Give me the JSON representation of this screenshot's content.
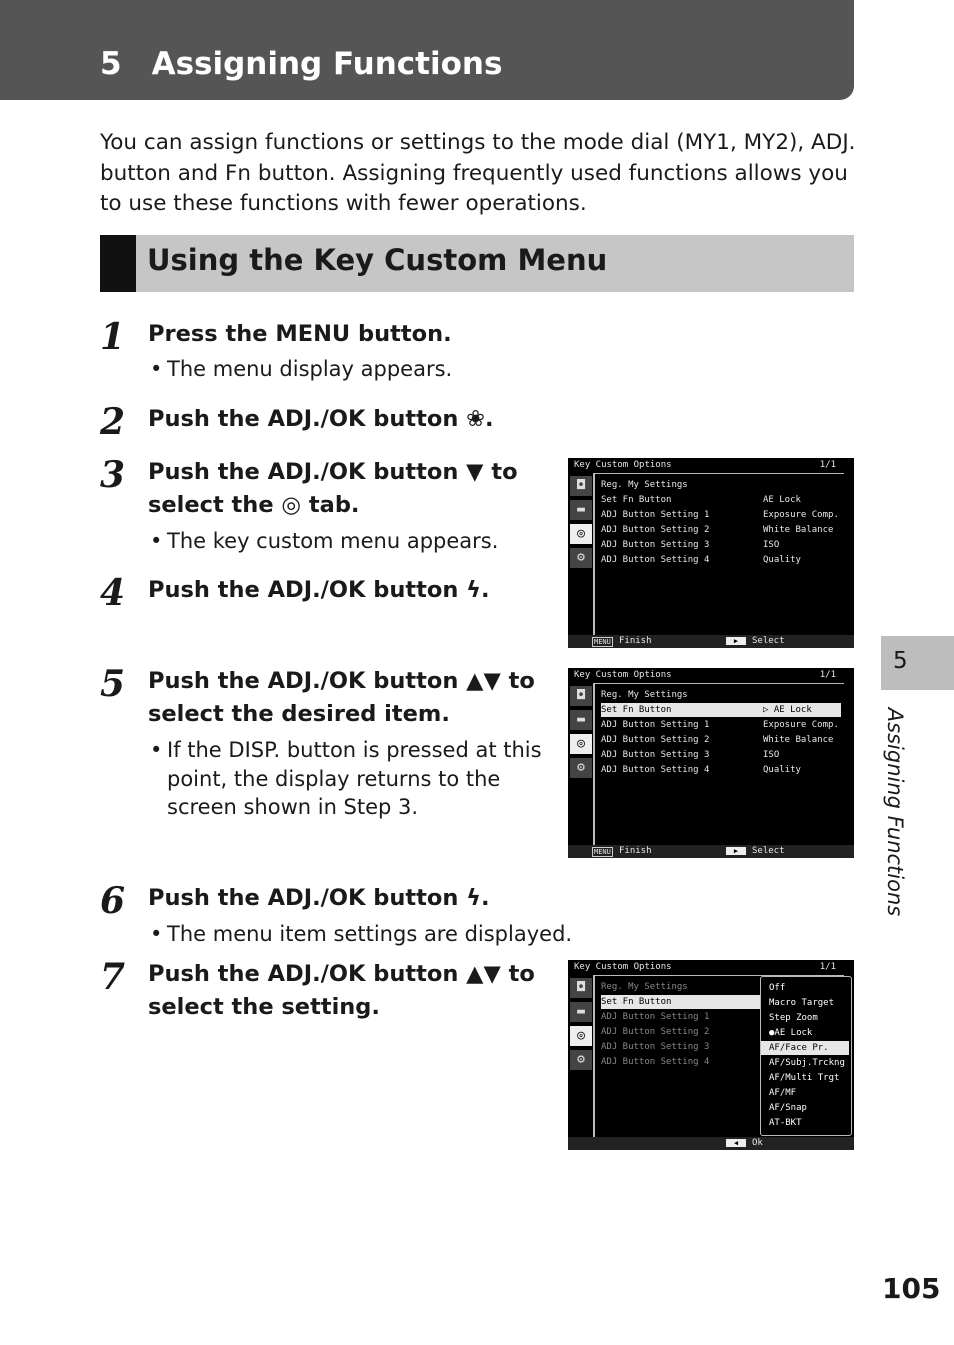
{
  "header": {
    "chapter": "5",
    "title": "Assigning Functions"
  },
  "intro": "You can assign functions or settings to the mode dial (MY1, MY2), ADJ. button and Fn button. Assigning frequently used functions allows you to use these functions with fewer operations.",
  "section_title": "Using the Key Custom Menu",
  "steps": [
    {
      "n": "1",
      "lines": [
        "Press the MENU button."
      ],
      "bullet": [
        "The menu display appears."
      ]
    },
    {
      "n": "2",
      "lines": [
        "Push the ADJ./OK button ❀."
      ]
    },
    {
      "n": "3",
      "lines": [
        "Push the ADJ./OK button ▼ to",
        "select the ◎ tab."
      ],
      "bullet": [
        "The key custom menu appears."
      ]
    },
    {
      "n": "4",
      "lines": [
        "Push the ADJ./OK button ϟ."
      ]
    },
    {
      "n": "5",
      "lines": [
        "Push the ADJ./OK button ▲▼ to",
        "select the desired item."
      ],
      "bullet": [
        "If the DISP. button is pressed at this",
        "point, the display returns to the",
        "screen shown in Step 3."
      ]
    },
    {
      "n": "6",
      "lines": [
        "Push the ADJ./OK button ϟ."
      ],
      "bullet": [
        "The menu item settings are displayed."
      ]
    },
    {
      "n": "7",
      "lines": [
        "Push the ADJ./OK button ▲▼ to",
        "select the setting."
      ]
    }
  ],
  "screens": [
    {
      "title": "Key Custom Options",
      "page": "1/1",
      "highlight": -1,
      "dim": false,
      "items": [
        "Reg. My Settings",
        "Set Fn Button",
        "ADJ Button Setting 1",
        "ADJ Button Setting 2",
        "ADJ Button Setting 3",
        "ADJ Button Setting 4"
      ],
      "values": [
        "",
        "AE Lock",
        "Exposure Comp.",
        "White Balance",
        "ISO",
        "Quality"
      ],
      "footer_left": "Finish",
      "footer_right": "Select"
    },
    {
      "title": "Key Custom Options",
      "page": "1/1",
      "highlight": 1,
      "dim": false,
      "items": [
        "Reg. My Settings",
        "Set Fn Button",
        "ADJ Button Setting 1",
        "ADJ Button Setting 2",
        "ADJ Button Setting 3",
        "ADJ Button Setting 4"
      ],
      "values": [
        "",
        "▷ AE Lock",
        "Exposure Comp.",
        "White Balance",
        "ISO",
        "Quality"
      ],
      "footer_left": "Finish",
      "footer_right": "Select"
    },
    {
      "title": "Key Custom Options",
      "page": "1/1",
      "highlight": 1,
      "dim": true,
      "items": [
        "Reg. My Settings",
        "Set Fn Button",
        "ADJ Button Setting 1",
        "ADJ Button Setting 2",
        "ADJ Button Setting 3",
        "ADJ Button Setting 4"
      ],
      "values": [
        "",
        "",
        "",
        "",
        "",
        ""
      ],
      "popup": [
        "Off",
        "Macro Target",
        "Step Zoom",
        "●AE Lock",
        "AF/Face Pr.",
        "AF/Subj.Trckng",
        "AF/Multi Trgt",
        "AF/MF",
        "AF/Snap",
        "AT-BKT"
      ],
      "popup_selected": 4,
      "footer_ok": "Ok"
    }
  ],
  "footer_menu_key": "MENU",
  "side_tab": {
    "number": "5",
    "label": "Assigning Functions"
  },
  "page_number": "105"
}
